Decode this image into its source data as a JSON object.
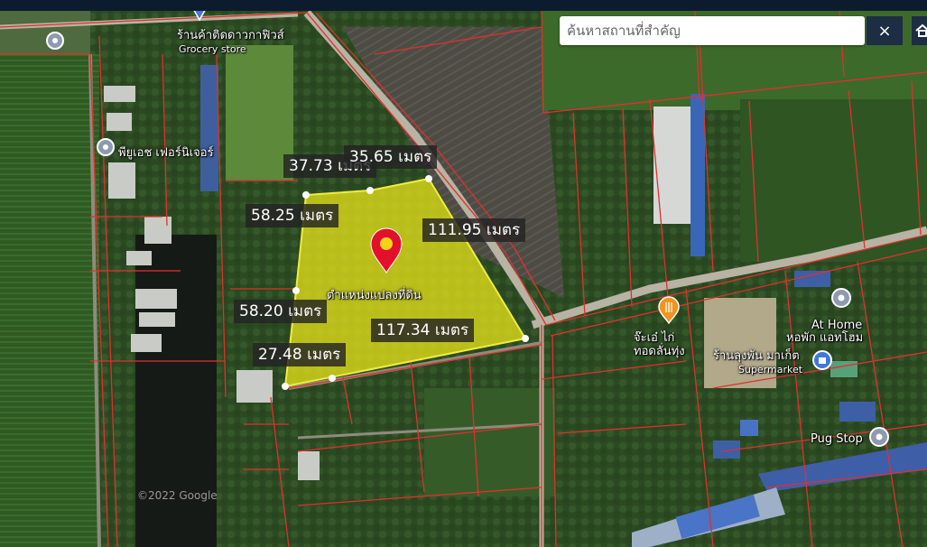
{
  "search": {
    "placeholder": "ค้นหาสถานที่สำคัญ"
  },
  "buttons": {
    "close_label": "×"
  },
  "icons": {
    "close": "close-icon",
    "home": "home-icon",
    "location_pin": "location-pin-icon",
    "poi_pin": "poi-pin-icon",
    "food": "food-icon",
    "shopping": "shopping-bag-icon"
  },
  "colors": {
    "parcel_fill": "#e3df1a",
    "parcel_stroke": "#f0ec40",
    "boundary": "#e0302e",
    "marker": "#e2102c",
    "topbar": "#0d1b2e"
  },
  "plot": {
    "label": "ตำแหน่งแปลงที่ดิน"
  },
  "dimensions": [
    {
      "text": "37.73 เมตร"
    },
    {
      "text": "35.65 เมตร"
    },
    {
      "text": "58.25 เมตร"
    },
    {
      "text": "111.95 เมตร"
    },
    {
      "text": "58.20 เมตร"
    },
    {
      "text": "117.34 เมตร"
    },
    {
      "text": "27.48 เมตร"
    }
  ],
  "pois": {
    "grocery_name": "ร้านค้าติดดาวกาฟิวส์",
    "grocery_type": "Grocery store",
    "furniture": "พียูเอช เฟอร์นิเจอร์",
    "chicken_line1": "จ๊ะเอ๋ ไก่",
    "chicken_line2": "ทอดลั่นทุ่ง",
    "athome_en": "At Home",
    "athome_th": "หอพัก แอทโฮม",
    "supermarket_th": "ร้านลุงพัน มาเก็ต",
    "supermarket_type": "Supermarket",
    "pugstop": "Pug Stop"
  },
  "attribution": "©2022 Google"
}
